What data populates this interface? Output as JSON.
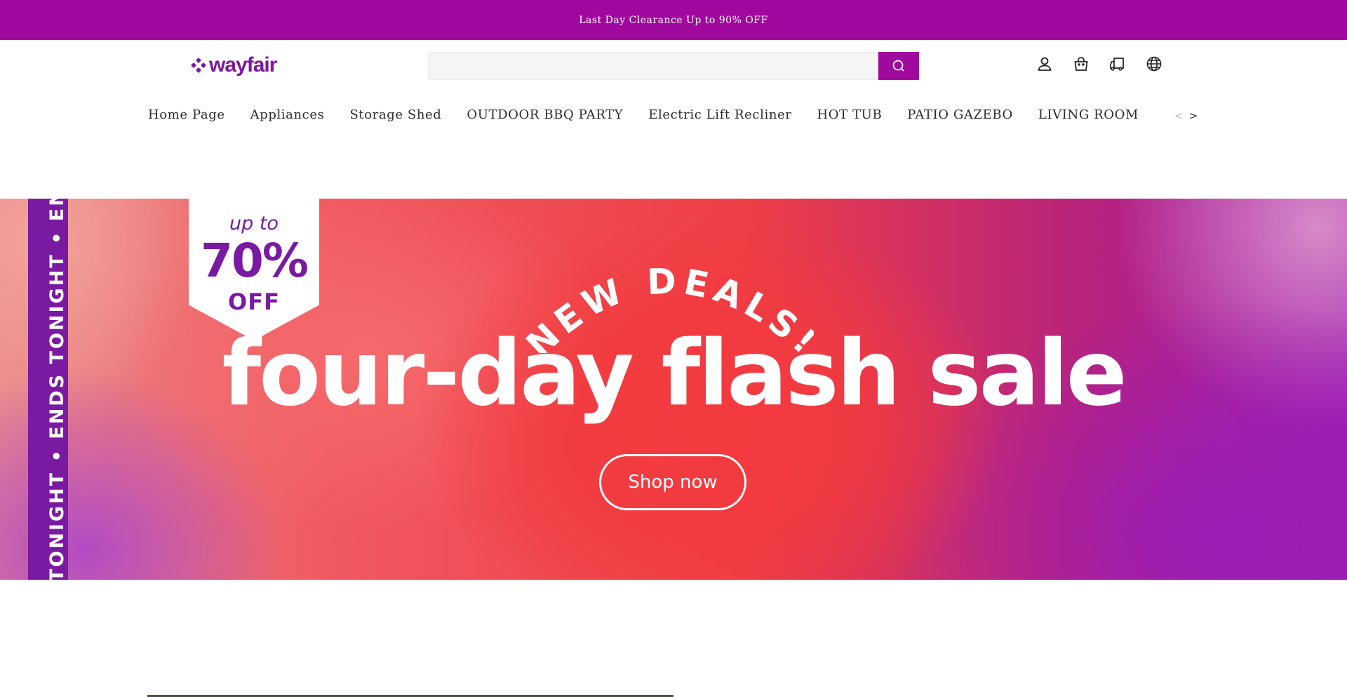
{
  "announcement": {
    "text": "Last Day Clearance Up to 90% OFF"
  },
  "header": {
    "logo_text": "wayfair",
    "search": {
      "placeholder": "",
      "value": ""
    },
    "icons": [
      "account-icon",
      "cart-icon",
      "order-tracking-icon",
      "language-icon"
    ]
  },
  "nav": {
    "items": [
      {
        "label": "Home Page"
      },
      {
        "label": "Appliances"
      },
      {
        "label": "Storage Shed"
      },
      {
        "label": "OUTDOOR BBQ PARTY"
      },
      {
        "label": "Electric Lift Recliner"
      },
      {
        "label": "HOT TUB"
      },
      {
        "label": "PATIO GAZEBO"
      },
      {
        "label": "LIVING ROOM"
      }
    ],
    "prev": "<",
    "next": ">"
  },
  "hero": {
    "ribbon_text": "TONIGHT  •  ENDS TONIGHT  •  END",
    "badge": {
      "up_to": "up to",
      "percent": "70%",
      "off": "OFF"
    },
    "arc_text": "NEW DEALS!",
    "headline": "four-day flash sale",
    "cta": "Shop now"
  },
  "colors": {
    "brand_purple": "#a0099d",
    "logo_purple": "#7b189f",
    "ribbon_purple": "#7a1aa2",
    "hero_red": "#ef3f46"
  }
}
